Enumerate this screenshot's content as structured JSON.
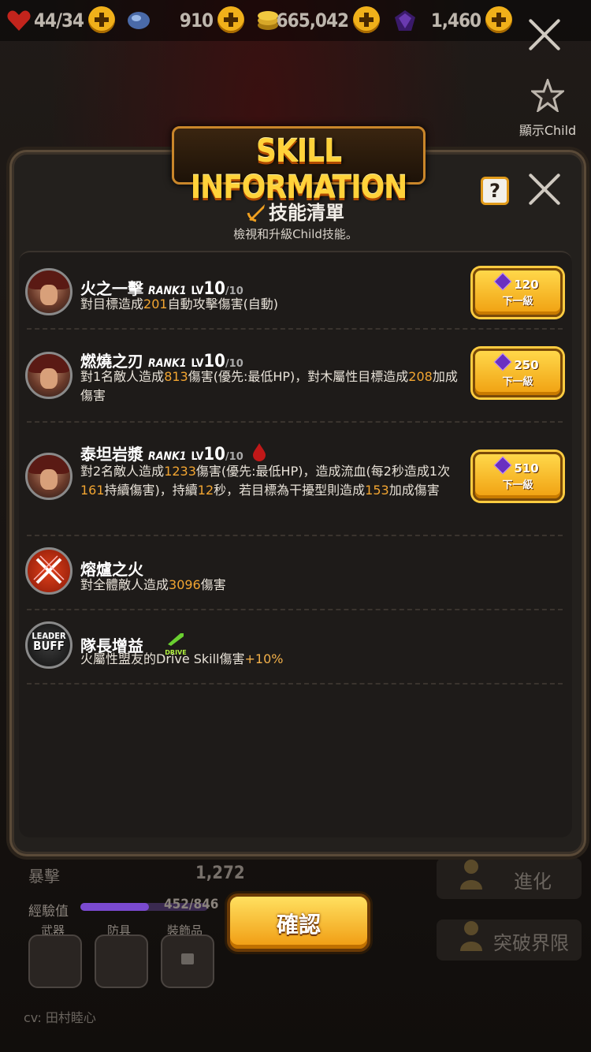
{
  "topbar": {
    "stamina": "44/34",
    "gems": "910",
    "gold": "665,042",
    "crystals": "1,460",
    "show_child_label": "顯示Child"
  },
  "panel": {
    "title": "SKILL INFORMATION",
    "help_label": "?",
    "subtitle": "技能清單",
    "description": "檢視和升級Child技能。"
  },
  "skills": [
    {
      "name": "火之一擊",
      "rank": "RANK1",
      "lv_label": "LV",
      "lv": "10",
      "lv_max": "/10",
      "desc_parts": [
        "對目標造成",
        "201",
        "自動攻擊傷害(自動)"
      ],
      "cost": "120",
      "button": "下一級"
    },
    {
      "name": "燃燒之刃",
      "rank": "RANK1",
      "lv_label": "LV",
      "lv": "10",
      "lv_max": "/10",
      "desc_parts": [
        "對1名敵人造成",
        "813",
        "傷害(優先:最低HP)，對木屬性目標造成",
        "208",
        "加成傷害"
      ],
      "cost": "250",
      "button": "下一級"
    },
    {
      "name": "泰坦岩漿",
      "rank": "RANK1",
      "lv_label": "LV",
      "lv": "10",
      "lv_max": "/10",
      "desc_parts": [
        "對2名敵人造成",
        "1233",
        "傷害(優先:最低HP)，造成流血(每2秒造成1次",
        "161",
        "持續傷害)，持續",
        "12",
        "秒，若目標為干擾型則造成",
        "153",
        "加成傷害"
      ],
      "cost": "510",
      "button": "下一級"
    },
    {
      "name": "熔爐之火",
      "desc_parts": [
        "對全體敵人造成",
        "3096",
        "傷害"
      ]
    },
    {
      "name": "隊長增益",
      "avatar_text_top": "LEADER",
      "avatar_text_bottom": "BUFF",
      "badge": "DRIVE",
      "desc_parts": [
        "火屬性盟友的Drive Skill傷害",
        "+10%"
      ]
    }
  ],
  "bottom": {
    "crit_label": "暴擊",
    "crit_value": "1,272",
    "exp_label": "經驗值",
    "exp_value": "452/846",
    "exp_progress": 0.534,
    "slot_weapon": "武器",
    "slot_armor": "防具",
    "slot_accessory": "裝飾品",
    "cv": "cv: 田村睦心",
    "evolve": "進化",
    "limit_break": "突破界限"
  },
  "confirm": "確認",
  "colors": {
    "accent_gold": "#f0b01a",
    "highlight_number": "#f2a531",
    "panel_bg": "#23201d"
  }
}
